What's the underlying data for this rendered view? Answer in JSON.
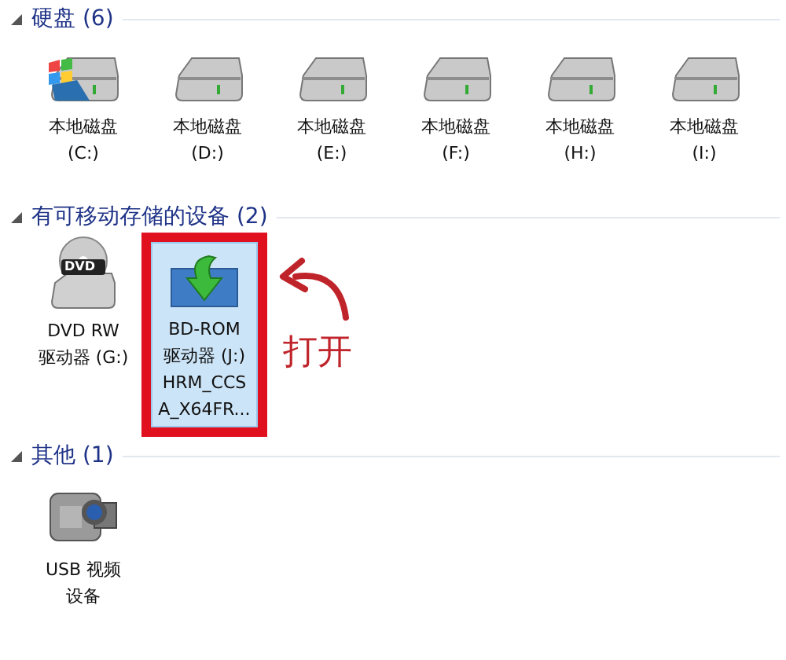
{
  "sections": [
    {
      "title": "硬盘 (6)",
      "expanded": true,
      "items": [
        {
          "kind": "system-drive",
          "lines": [
            "本地磁盘",
            "(C:)"
          ],
          "selected": false,
          "highlighted": false
        },
        {
          "kind": "drive",
          "lines": [
            "本地磁盘",
            "(D:)"
          ],
          "selected": false,
          "highlighted": false
        },
        {
          "kind": "drive",
          "lines": [
            "本地磁盘",
            "(E:)"
          ],
          "selected": false,
          "highlighted": false
        },
        {
          "kind": "drive",
          "lines": [
            "本地磁盘",
            "(F:)"
          ],
          "selected": false,
          "highlighted": false
        },
        {
          "kind": "drive",
          "lines": [
            "本地磁盘",
            "(H:)"
          ],
          "selected": false,
          "highlighted": false
        },
        {
          "kind": "drive",
          "lines": [
            "本地磁盘",
            "(I:)"
          ],
          "selected": false,
          "highlighted": false
        }
      ]
    },
    {
      "title": "有可移动存储的设备 (2)",
      "expanded": true,
      "items": [
        {
          "kind": "dvd",
          "badge": "DVD",
          "lines": [
            "DVD RW",
            "驱动器 (G:)"
          ],
          "selected": false,
          "highlighted": false
        },
        {
          "kind": "disc",
          "lines": [
            "BD-ROM",
            "驱动器 (J:)",
            "HRM_CCS",
            "A_X64FR..."
          ],
          "selected": true,
          "highlighted": true
        }
      ]
    },
    {
      "title": "其他 (1)",
      "expanded": true,
      "items": [
        {
          "kind": "camera",
          "lines": [
            "USB 视频",
            "设备"
          ],
          "selected": false,
          "highlighted": false
        }
      ]
    }
  ],
  "annotation": {
    "label": "打开"
  }
}
